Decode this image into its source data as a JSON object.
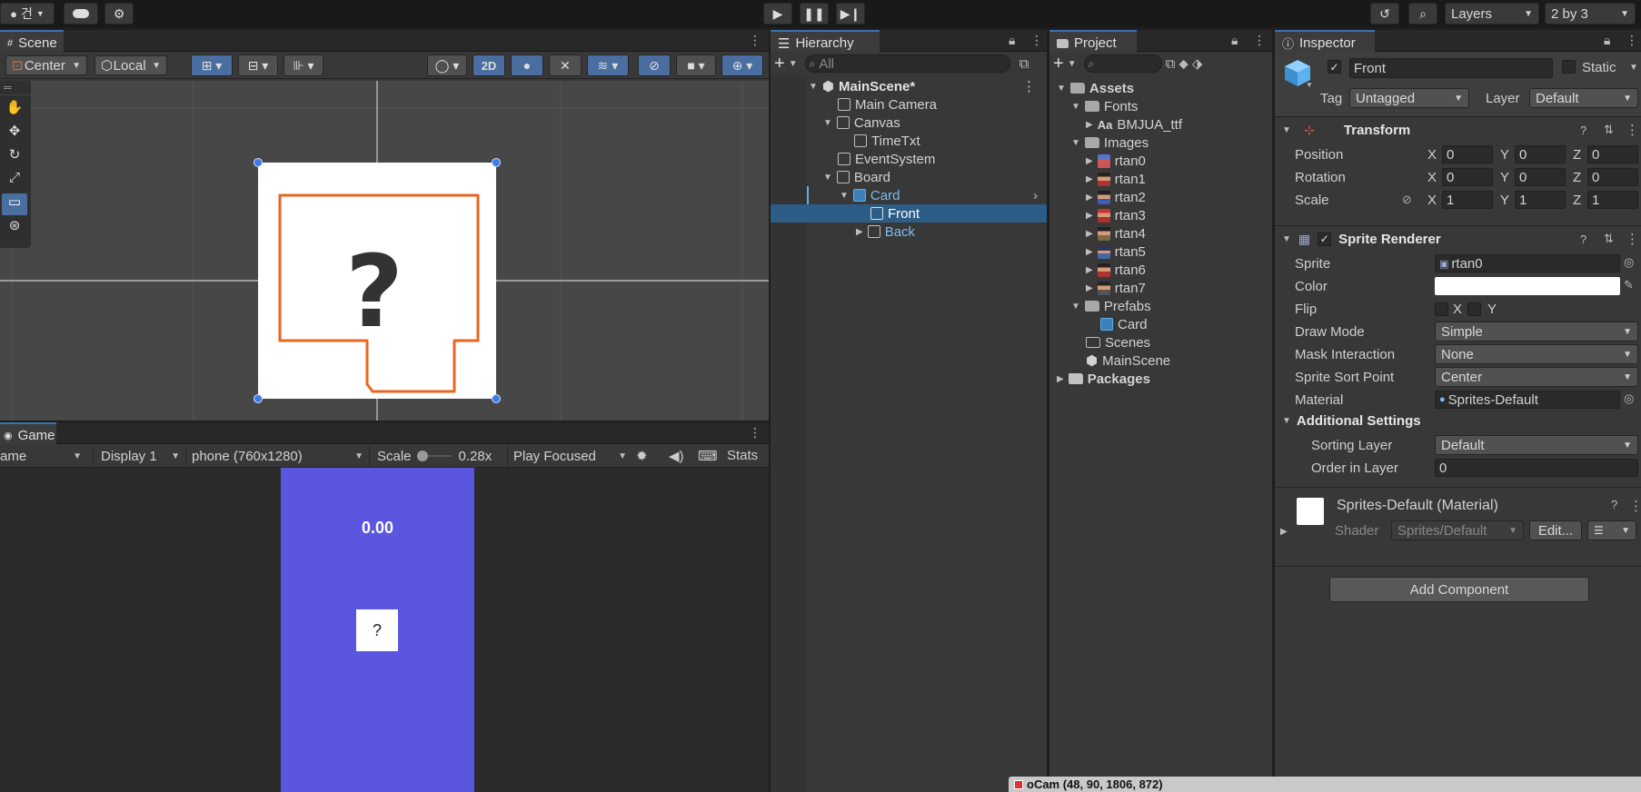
{
  "toolbar": {
    "account_label": "건",
    "layers_label": "Layers",
    "layout_label": "2 by 3"
  },
  "scene": {
    "tab_label": "Scene",
    "pivot_label": "Center",
    "space_label": "Local",
    "mode_2d_label": "2D"
  },
  "game": {
    "tab_label": "Game",
    "view_label": "ame",
    "display_label": "Display 1",
    "resolution_label": "phone (760x1280)",
    "scale_label": "Scale",
    "scale_value": "0.28x",
    "play_mode_label": "Play Focused",
    "stats_label": "Stats",
    "time_text": "0.00",
    "card_text": "?",
    "background_color": "#5a56e0"
  },
  "hierarchy": {
    "tab_label": "Hierarchy",
    "search_placeholder": "All",
    "items": [
      {
        "label": "MainScene*"
      },
      {
        "label": "Main Camera"
      },
      {
        "label": "Canvas"
      },
      {
        "label": "TimeTxt"
      },
      {
        "label": "EventSystem"
      },
      {
        "label": "Board"
      },
      {
        "label": "Card"
      },
      {
        "label": "Front"
      },
      {
        "label": "Back"
      }
    ]
  },
  "project": {
    "tab_label": "Project",
    "items": [
      {
        "label": "Assets"
      },
      {
        "label": "Fonts"
      },
      {
        "label": "BMJUA_ttf",
        "prefix": "Aa"
      },
      {
        "label": "Images"
      },
      {
        "label": "rtan0"
      },
      {
        "label": "rtan1"
      },
      {
        "label": "rtan2"
      },
      {
        "label": "rtan3"
      },
      {
        "label": "rtan4"
      },
      {
        "label": "rtan5"
      },
      {
        "label": "rtan6"
      },
      {
        "label": "rtan7"
      },
      {
        "label": "Prefabs"
      },
      {
        "label": "Card"
      },
      {
        "label": "Scenes"
      },
      {
        "label": "MainScene"
      },
      {
        "label": "Packages"
      }
    ]
  },
  "inspector": {
    "tab_label": "Inspector",
    "object_name": "Front",
    "static_label": "Static",
    "tag_label": "Tag",
    "tag_value": "Untagged",
    "layer_label": "Layer",
    "layer_value": "Default",
    "transform": {
      "title": "Transform",
      "position_label": "Position",
      "rotation_label": "Rotation",
      "scale_label": "Scale",
      "x_label": "X",
      "y_label": "Y",
      "z_label": "Z",
      "position": [
        "0",
        "0",
        "0"
      ],
      "rotation": [
        "0",
        "0",
        "0"
      ],
      "scale": [
        "1",
        "1",
        "1"
      ]
    },
    "sprite_renderer": {
      "title": "Sprite Renderer",
      "sprite_label": "Sprite",
      "sprite_value": "rtan0",
      "color_label": "Color",
      "color_value": "#ffffff",
      "flip_label": "Flip",
      "flip_x_label": "X",
      "flip_y_label": "Y",
      "draw_mode_label": "Draw Mode",
      "draw_mode_value": "Simple",
      "mask_label": "Mask Interaction",
      "mask_value": "None",
      "sort_point_label": "Sprite Sort Point",
      "sort_point_value": "Center",
      "material_label": "Material",
      "material_value": "Sprites-Default",
      "additional_label": "Additional Settings",
      "sorting_layer_label": "Sorting Layer",
      "sorting_layer_value": "Default",
      "order_label": "Order in Layer",
      "order_value": "0"
    },
    "material": {
      "title": "Sprites-Default (Material)",
      "shader_label": "Shader",
      "shader_value": "Sprites/Default",
      "edit_label": "Edit..."
    },
    "add_component_label": "Add Component"
  },
  "status": {
    "camera_text": "oCam (48, 90, 1806, 872)"
  }
}
